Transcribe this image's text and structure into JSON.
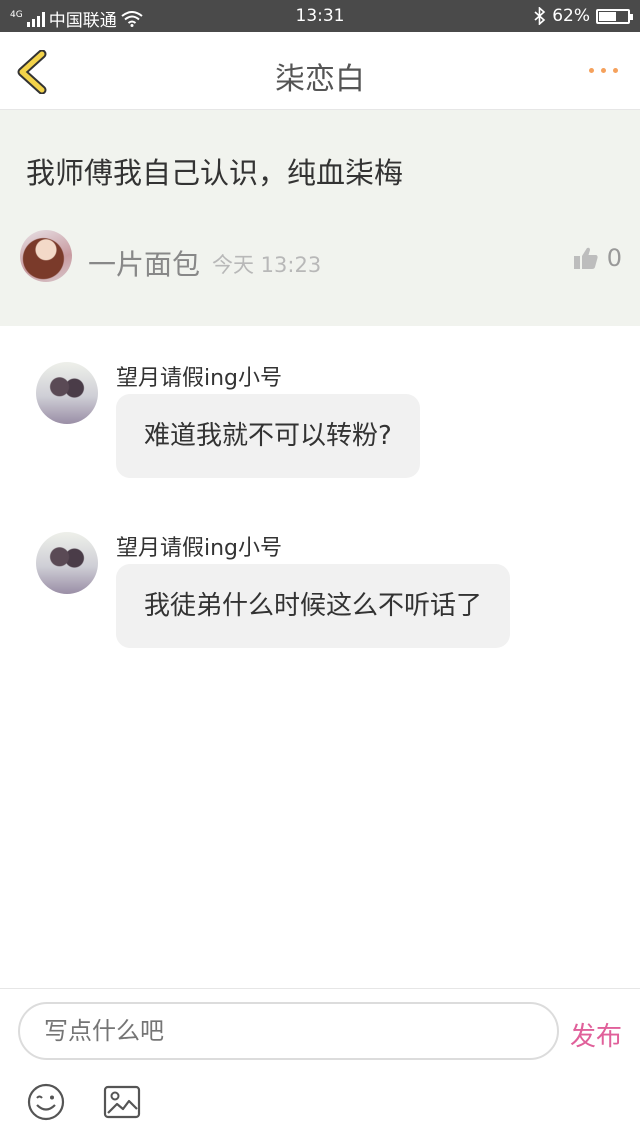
{
  "status_bar": {
    "network_type": "4G",
    "carrier": "中国联通",
    "time": "13:31",
    "battery": "62%",
    "battery_level": 0.62
  },
  "nav": {
    "title": "柒恋白",
    "back_icon": "chevron-left-icon",
    "more_icon": "more-dots-icon",
    "accent": "#f5a15c"
  },
  "post": {
    "text": "我师傅我自己认识，纯血柒梅",
    "user": "一片面包",
    "time": "今天 13:23",
    "likes": "0",
    "background": "#f1f3ee"
  },
  "comments": [
    {
      "user": "望月请假ing小号",
      "text": "难道我就不可以转粉?"
    },
    {
      "user": "望月请假ing小号",
      "text": "我徒弟什么时候这么不听话了"
    }
  ],
  "composer": {
    "placeholder": "写点什么吧",
    "send_label": "发布",
    "send_color": "#e0609a",
    "tools": [
      "emoji-icon",
      "image-icon"
    ]
  }
}
